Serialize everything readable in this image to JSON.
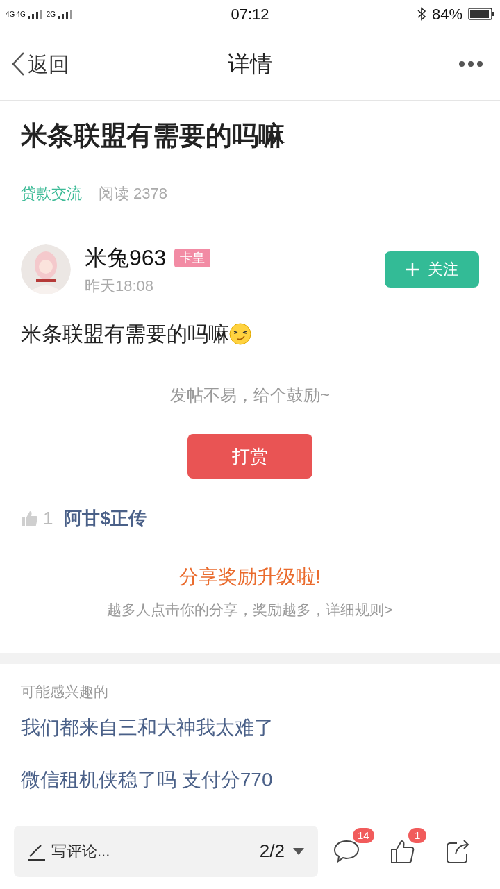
{
  "status_bar": {
    "network_1": "4G",
    "network_2": "4G",
    "network_3": "2G",
    "time": "07:12",
    "battery": "84%"
  },
  "nav": {
    "back": "返回",
    "title": "详情"
  },
  "post": {
    "title": "米条联盟有需要的吗嘛",
    "category": "贷款交流",
    "reads": "阅读 2378",
    "author": {
      "name": "米兔963",
      "badge": "卡皇",
      "time": "昨天18:08",
      "follow": "关注",
      "followed": false
    },
    "body": "米条联盟有需要的吗嘛",
    "encourage": "发帖不易，给个鼓励~",
    "reward": "打赏",
    "likes": {
      "count": "1",
      "users": "阿甘$正传"
    }
  },
  "share": {
    "title": "分享奖励升级啦!",
    "subtitle": "越多人点击你的分享，奖励越多，详细规则>"
  },
  "related": {
    "heading": "可能感兴趣的",
    "items": [
      "我们都来自三和大神我太难了",
      "微信租机侠稳了吗 支付分770"
    ]
  },
  "bottom_bar": {
    "comment_placeholder": "写评论...",
    "page": "2/2",
    "comments_badge": "14",
    "likes_badge": "1"
  }
}
